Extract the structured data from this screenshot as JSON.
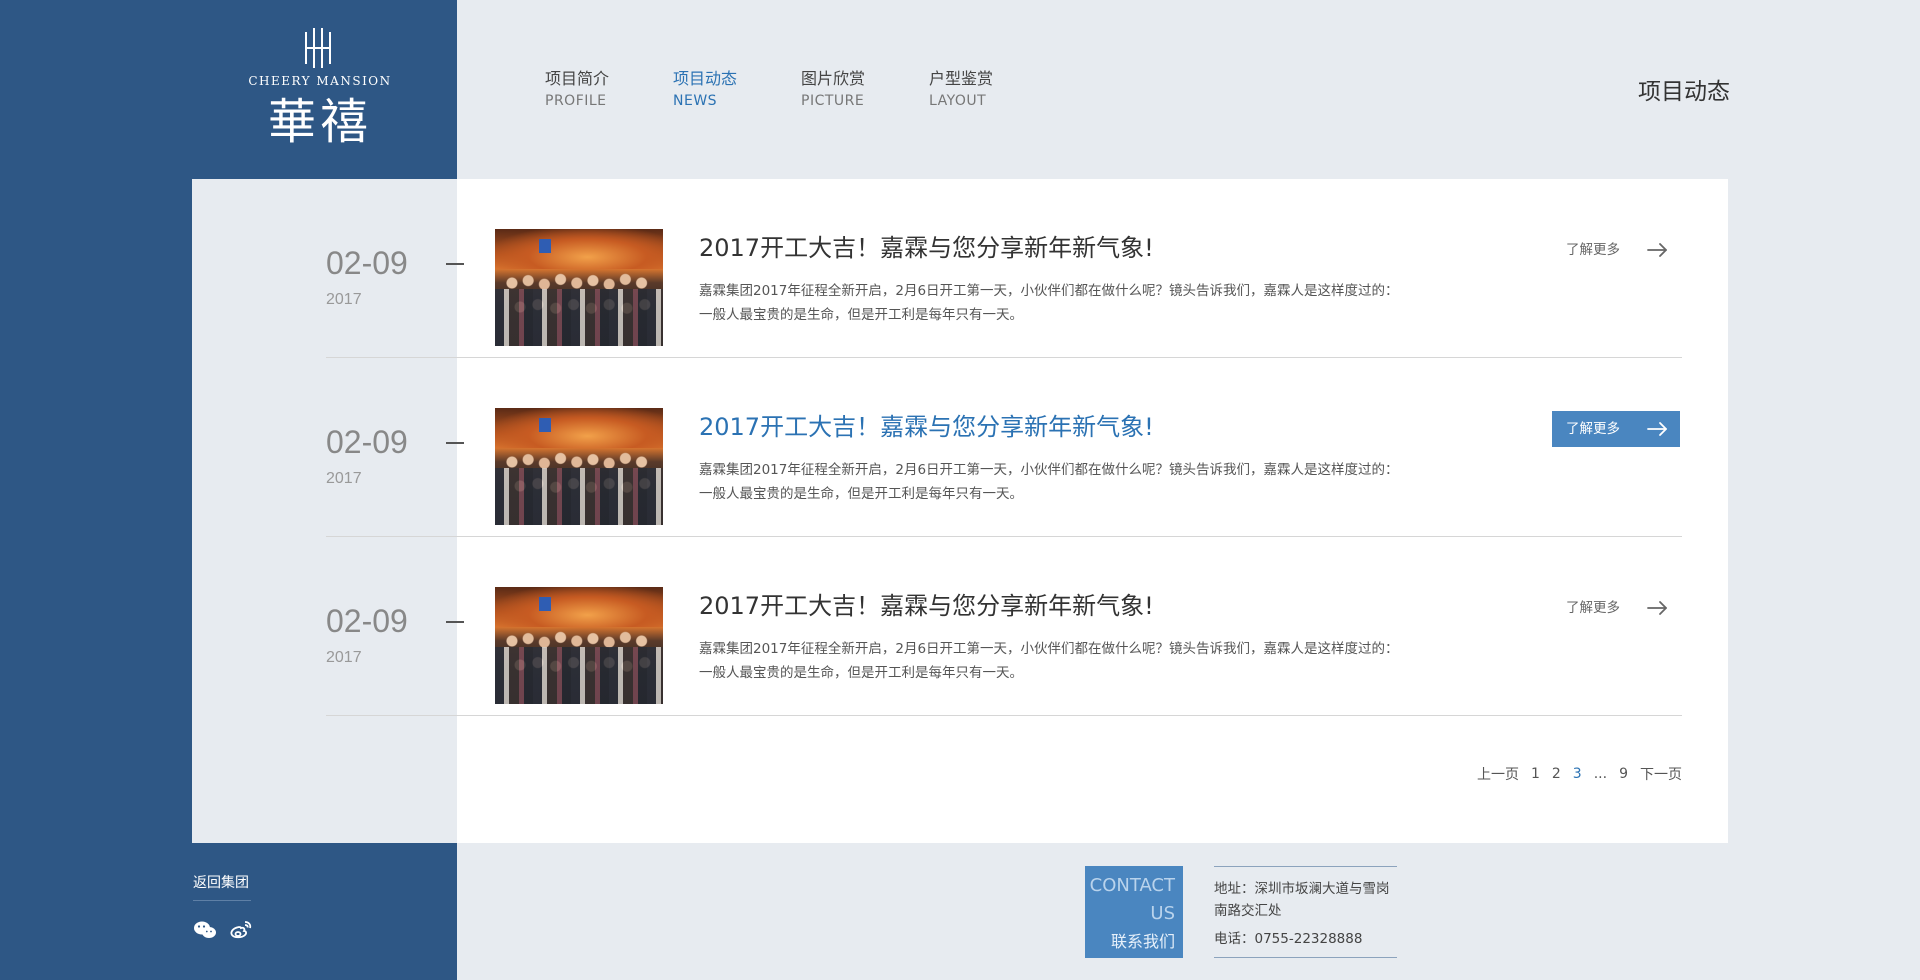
{
  "brand": {
    "name_en": "CHEERY MANSION",
    "name_cn": "華禧",
    "logo_icon": "brand-monogram-icon",
    "band_color": "#2e5785"
  },
  "nav": [
    {
      "cn": "项目简介",
      "en": "PROFILE"
    },
    {
      "cn": "项目动态",
      "en": "NEWS"
    },
    {
      "cn": "图片欣赏",
      "en": "PICTURE"
    },
    {
      "cn": "户型鉴赏",
      "en": "LAYOUT"
    }
  ],
  "active_nav_index": 1,
  "page_heading": "项目动态",
  "accent_color": "#2b72b3",
  "news": [
    {
      "day": "02-09",
      "year": "2017",
      "title": "2017开工大吉！嘉霖与您分享新年新气象!",
      "desc": "嘉霖集团2017年征程全新开启，2月6日开工第一天，小伙伴们都在做什么呢？镜头告诉我们，嘉霖人是这样度过的：一般人最宝贵的是生命，但是开工利是每年只有一天。",
      "more_label": "了解更多"
    },
    {
      "day": "02-09",
      "year": "2017",
      "title": "2017开工大吉！嘉霖与您分享新年新气象!",
      "desc": "嘉霖集团2017年征程全新开启，2月6日开工第一天，小伙伴们都在做什么呢？镜头告诉我们，嘉霖人是这样度过的：一般人最宝贵的是生命，但是开工利是每年只有一天。",
      "more_label": "了解更多"
    },
    {
      "day": "02-09",
      "year": "2017",
      "title": "2017开工大吉！嘉霖与您分享新年新气象!",
      "desc": "嘉霖集团2017年征程全新开启，2月6日开工第一天，小伙伴们都在做什么呢？镜头告诉我们，嘉霖人是这样度过的：一般人最宝贵的是生命，但是开工利是每年只有一天。",
      "more_label": "了解更多"
    }
  ],
  "active_news_index": 1,
  "pagination": {
    "prev": "上一页",
    "pages": [
      "1",
      "2",
      "3"
    ],
    "ellipsis": "...",
    "last": "9",
    "next": "下一页",
    "current": "3"
  },
  "footer": {
    "back_label": "返回集团",
    "social_icons": [
      "wechat-icon",
      "weibo-icon"
    ],
    "contact_en_1": "CONTACT",
    "contact_en_2": "US",
    "contact_cn": "联系我们",
    "address": "地址：深圳市坂澜大道与雪岗南路交汇处",
    "phone": "电话：0755-22328888"
  }
}
